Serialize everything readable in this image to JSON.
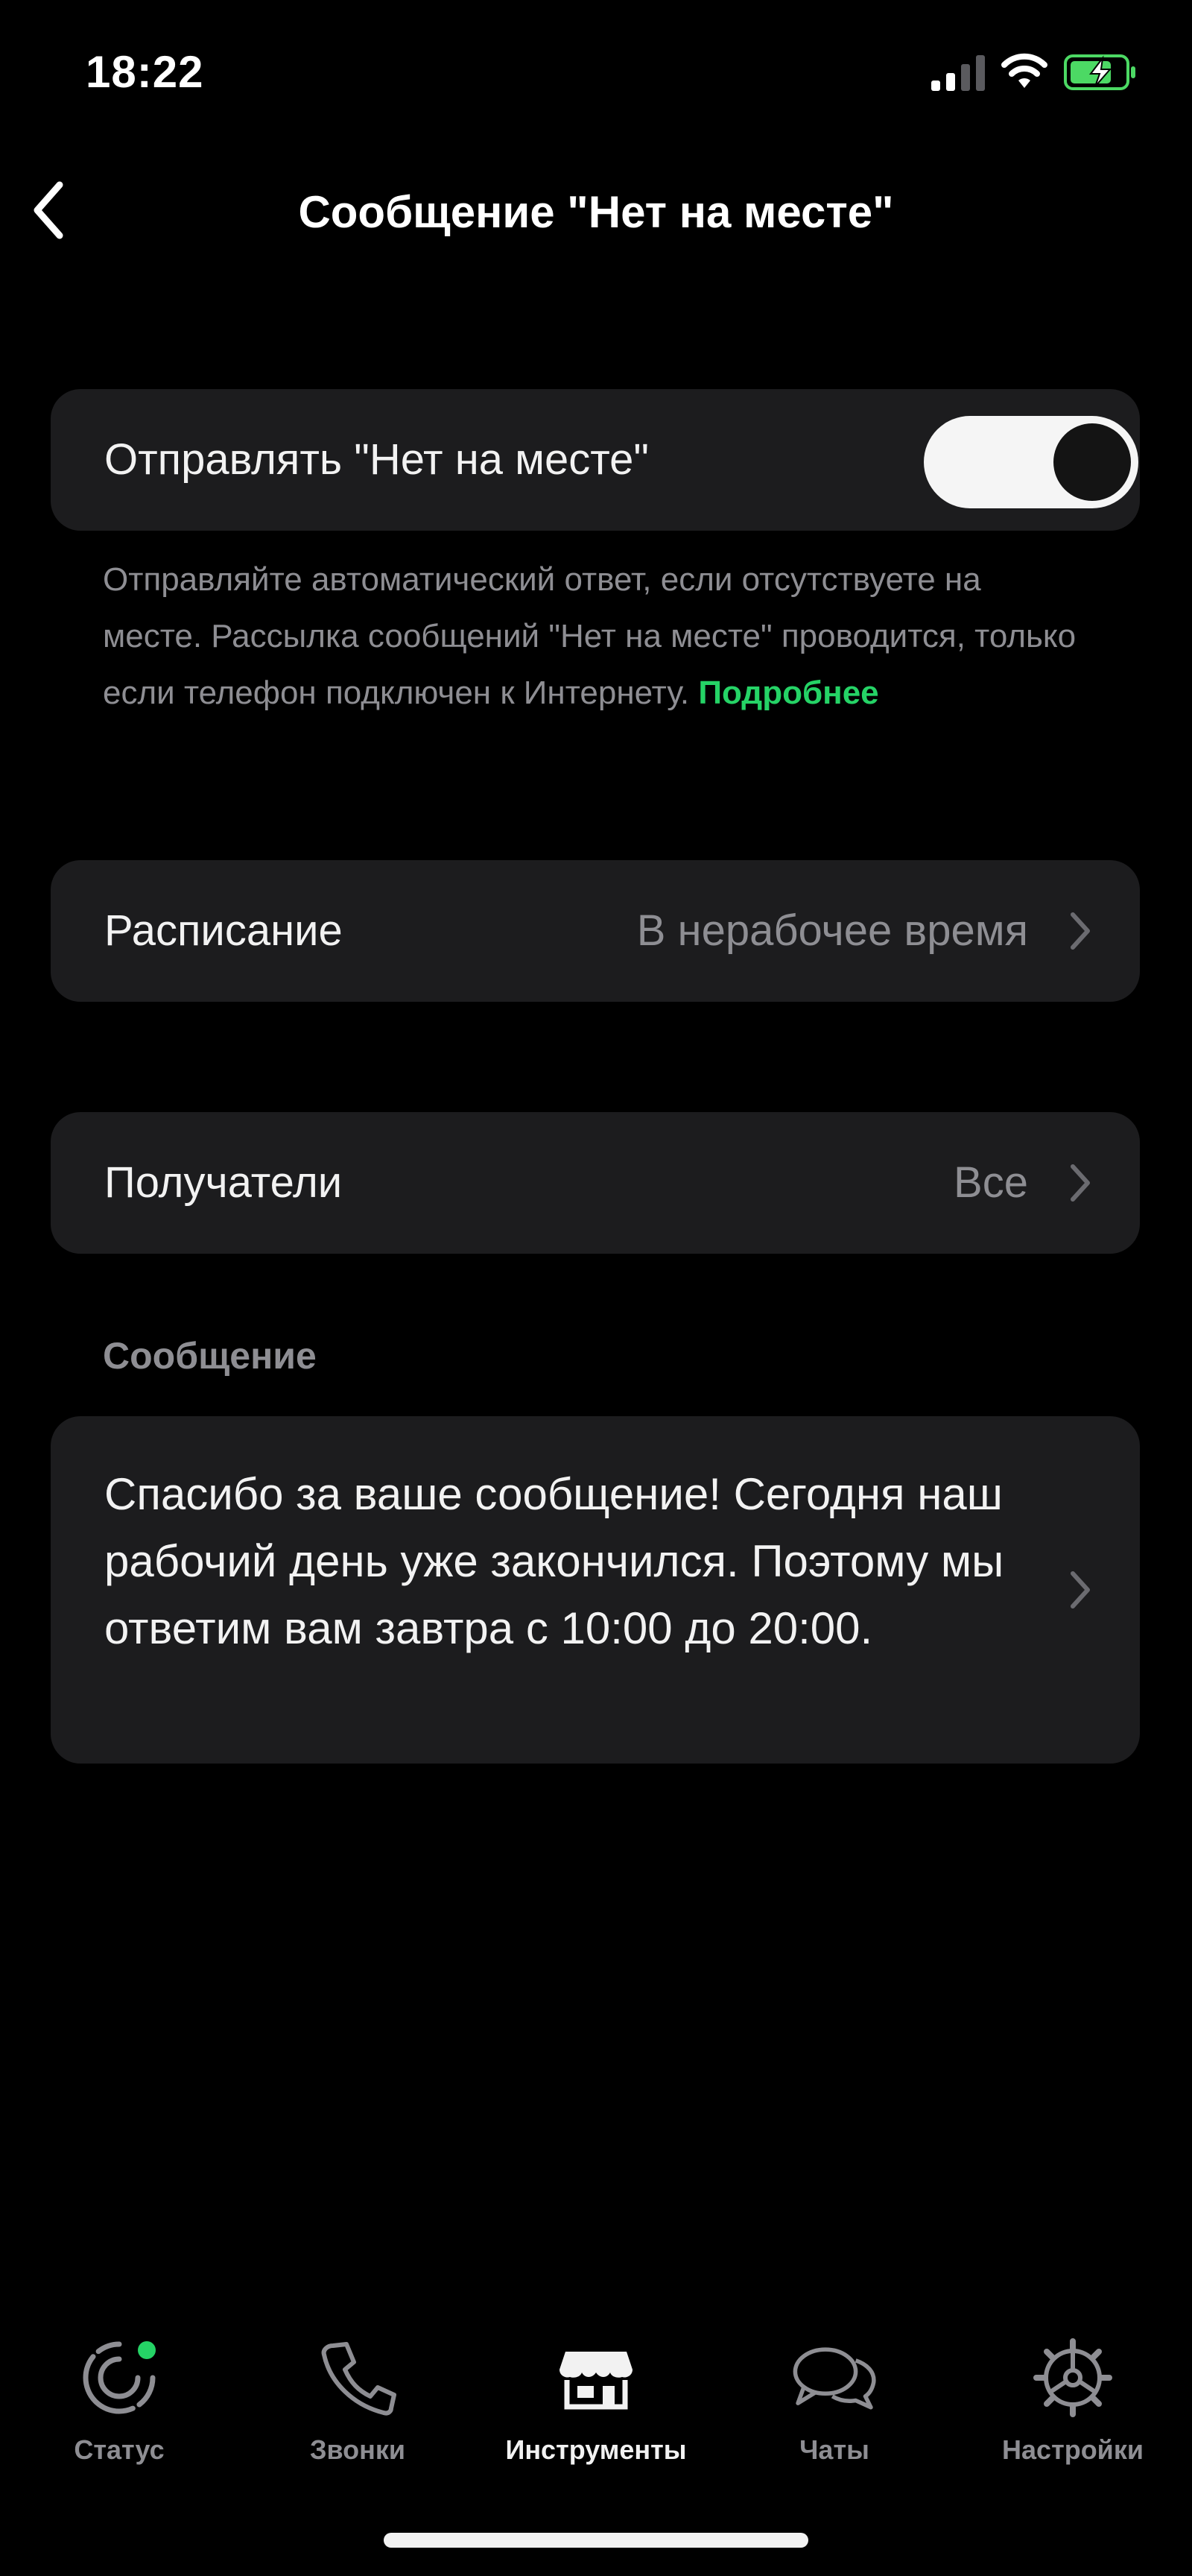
{
  "status_bar": {
    "time": "18:22",
    "icons": [
      "cellular-signal-icon",
      "wifi-icon",
      "battery-charging-icon"
    ],
    "battery_color": "#4cd964"
  },
  "nav": {
    "back_icon": "chevron-left-icon",
    "title": "Сообщение \"Нет на месте\""
  },
  "away_toggle": {
    "label": "Отправлять \"Нет на месте\"",
    "enabled": true
  },
  "hint": {
    "text": "Отправляйте автоматический ответ, если отсутствуете на месте. Рассылка сообщений \"Нет на месте\" проводится, только если телефон подключен к Интернету.",
    "link": "Подробнее",
    "link_color": "#25d366"
  },
  "schedule": {
    "label": "Расписание",
    "value": "В нерабочее время"
  },
  "recipients": {
    "label": "Получатели",
    "value": "Все"
  },
  "message_section": {
    "header": "Сообщение",
    "text": "Спасибо за ваше сообщение! Сегодня наш рабочий день уже закончился. Поэтому мы ответим вам завтра с 10:00 до 20:00."
  },
  "tab_bar": {
    "active": "tools",
    "tabs": [
      {
        "id": "status",
        "label": "Статус",
        "icon": "status-icon"
      },
      {
        "id": "calls",
        "label": "Звонки",
        "icon": "phone-icon"
      },
      {
        "id": "tools",
        "label": "Инструменты",
        "icon": "storefront-icon"
      },
      {
        "id": "chats",
        "label": "Чаты",
        "icon": "chat-bubbles-icon"
      },
      {
        "id": "settings",
        "label": "Настройки",
        "icon": "gear-icon"
      }
    ]
  },
  "colors": {
    "background": "#000000",
    "card": "#1c1c1e",
    "secondary_text": "#8e8e93",
    "accent": "#25d366"
  }
}
